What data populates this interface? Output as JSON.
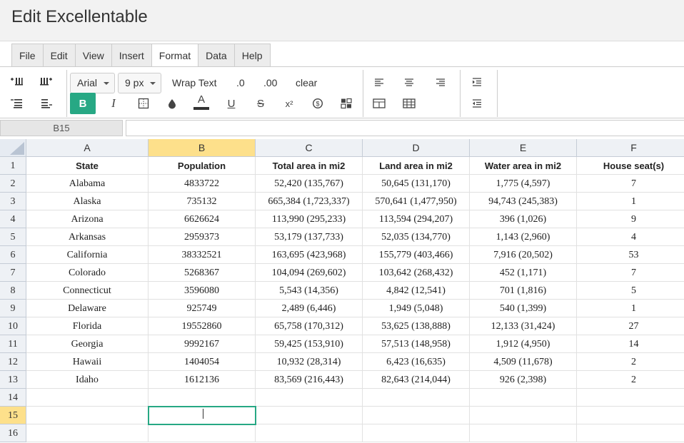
{
  "app": {
    "title": "Edit Excellentable"
  },
  "menu": {
    "tabs": [
      "File",
      "Edit",
      "View",
      "Insert",
      "Format",
      "Data",
      "Help"
    ],
    "active": "Format"
  },
  "toolbar": {
    "font_family": "Arial",
    "font_size": "9 px",
    "wrap_text": "Wrap Text",
    "decrease_decimal": ".0",
    "increase_decimal": ".00",
    "clear": "clear",
    "bold": "B",
    "italic": "I",
    "text_color": "A",
    "underline": "U",
    "strikethrough": "S",
    "superscript": "x²",
    "accent_color": "#27a884",
    "icons": [
      "insert-rows-above-icon",
      "insert-columns-icon",
      "delete-rows-icon",
      "delete-columns-icon",
      "border-icon",
      "fill-color-icon",
      "currency-icon",
      "conditional-format-icon",
      "align-left-icon",
      "align-center-icon",
      "align-right-icon",
      "merge-cells-icon",
      "table-icon",
      "indent-increase-icon",
      "indent-decrease-icon"
    ]
  },
  "formula_bar": {
    "cell_ref": "B15",
    "value": ""
  },
  "grid": {
    "columns": [
      "A",
      "B",
      "C",
      "D",
      "E",
      "F"
    ],
    "selected_column": "B",
    "selected_row": "15",
    "rows": [
      {
        "num": "1",
        "cells": [
          "State",
          "Population",
          "Total area in mi2",
          "Land area in mi2",
          "Water area in mi2",
          "House seat(s)"
        ]
      },
      {
        "num": "2",
        "cells": [
          "Alabama",
          "4833722",
          "52,420 (135,767)",
          "50,645 (131,170)",
          "1,775 (4,597)",
          "7"
        ]
      },
      {
        "num": "3",
        "cells": [
          "Alaska",
          "735132",
          "665,384 (1,723,337)",
          "570,641 (1,477,950)",
          "94,743 (245,383)",
          "1"
        ]
      },
      {
        "num": "4",
        "cells": [
          "Arizona",
          "6626624",
          "113,990 (295,233)",
          "113,594 (294,207)",
          "396 (1,026)",
          "9"
        ]
      },
      {
        "num": "5",
        "cells": [
          "Arkansas",
          "2959373",
          "53,179 (137,733)",
          "52,035 (134,770)",
          "1,143 (2,960)",
          "4"
        ]
      },
      {
        "num": "6",
        "cells": [
          "California",
          "38332521",
          "163,695 (423,968)",
          "155,779 (403,466)",
          "7,916 (20,502)",
          "53"
        ]
      },
      {
        "num": "7",
        "cells": [
          "Colorado",
          "5268367",
          "104,094 (269,602)",
          "103,642 (268,432)",
          "452 (1,171)",
          "7"
        ]
      },
      {
        "num": "8",
        "cells": [
          "Connecticut",
          "3596080",
          "5,543 (14,356)",
          "4,842 (12,541)",
          "701 (1,816)",
          "5"
        ]
      },
      {
        "num": "9",
        "cells": [
          "Delaware",
          "925749",
          "2,489 (6,446)",
          "1,949 (5,048)",
          "540 (1,399)",
          "1"
        ]
      },
      {
        "num": "10",
        "cells": [
          "Florida",
          "19552860",
          "65,758 (170,312)",
          "53,625 (138,888)",
          "12,133 (31,424)",
          "27"
        ]
      },
      {
        "num": "11",
        "cells": [
          "Georgia",
          "9992167",
          "59,425 (153,910)",
          "57,513 (148,958)",
          "1,912 (4,950)",
          "14"
        ]
      },
      {
        "num": "12",
        "cells": [
          "Hawaii",
          "1404054",
          "10,932 (28,314)",
          "6,423 (16,635)",
          "4,509 (11,678)",
          "2"
        ]
      },
      {
        "num": "13",
        "cells": [
          "Idaho",
          "1612136",
          "83,569 (216,443)",
          "82,643 (214,044)",
          "926 (2,398)",
          "2"
        ]
      },
      {
        "num": "14",
        "cells": [
          "",
          "",
          "",
          "",
          "",
          ""
        ]
      },
      {
        "num": "15",
        "cells": [
          "",
          "",
          "",
          "",
          "",
          ""
        ]
      },
      {
        "num": "16",
        "cells": [
          "",
          "",
          "",
          "",
          "",
          ""
        ]
      }
    ]
  }
}
